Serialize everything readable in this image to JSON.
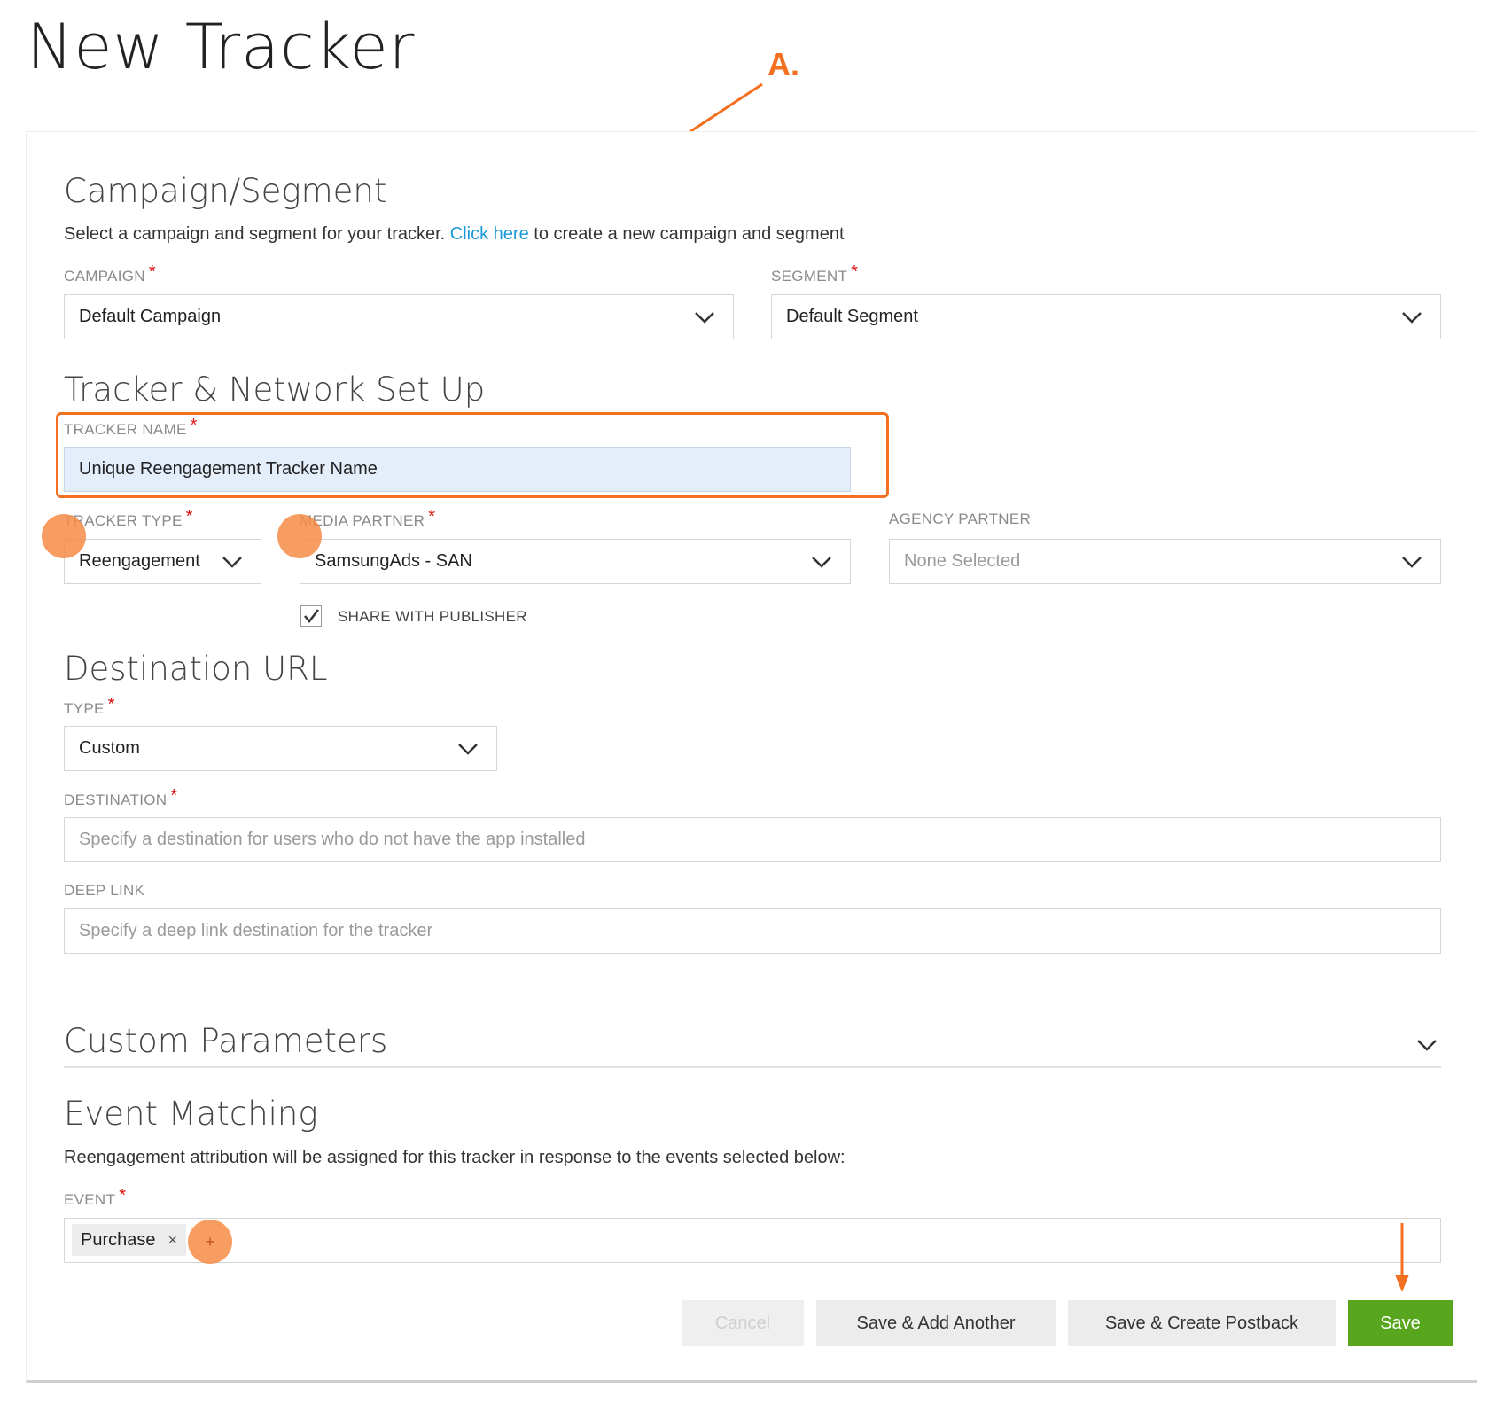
{
  "page": {
    "title": "New Tracker"
  },
  "annotation": {
    "marker": "A.",
    "color": "#f37021"
  },
  "campaign_segment": {
    "title": "Campaign/Segment",
    "description_prefix": "Select a campaign and segment for your tracker.",
    "link_text": "Click here",
    "description_suffix": "to create a new campaign and segment",
    "campaign": {
      "label": "CAMPAIGN",
      "value": "Default Campaign"
    },
    "segment": {
      "label": "SEGMENT",
      "value": "Default Segment"
    }
  },
  "tracker_network": {
    "title": "Tracker & Network Set Up",
    "tracker_name": {
      "label": "TRACKER NAME",
      "value": "Unique Reengagement Tracker Name"
    },
    "tracker_type": {
      "label": "TRACKER TYPE",
      "value": "Reengagement"
    },
    "media_partner": {
      "label": "MEDIA PARTNER",
      "value": "SamsungAds - SAN"
    },
    "agency_partner": {
      "label": "AGENCY PARTNER",
      "value": "None Selected"
    },
    "share_with_publisher": {
      "label": "SHARE WITH PUBLISHER",
      "checked": true
    }
  },
  "destination_url": {
    "title": "Destination URL",
    "type": {
      "label": "TYPE",
      "value": "Custom"
    },
    "destination": {
      "label": "DESTINATION",
      "placeholder": "Specify a destination for users who do not have the app installed"
    },
    "deep_link": {
      "label": "DEEP LINK",
      "placeholder": "Specify a deep link destination for the tracker"
    }
  },
  "custom_parameters": {
    "title": "Custom Parameters"
  },
  "event_matching": {
    "title": "Event Matching",
    "description": "Reengagement attribution will be assigned for this tracker in response to the events selected below:",
    "event": {
      "label": "EVENT",
      "tags": [
        "Purchase"
      ],
      "remove_symbol": "×",
      "add_symbol": "+"
    }
  },
  "actions": {
    "cancel": "Cancel",
    "save_add_another": "Save & Add Another",
    "save_create_postback": "Save & Create Postback",
    "save": "Save"
  },
  "colors": {
    "accent_orange": "#f37021",
    "link_blue": "#1a9ad9",
    "save_green": "#58a51e",
    "required_red": "#dd1111",
    "highlight_input": "#e4edfa"
  },
  "icons": {
    "dropdown": "chevron-down-icon",
    "checkbox": "checkmark-icon",
    "tag_remove": "close-icon",
    "add": "plus-icon",
    "annotation": "arrow-icon"
  }
}
